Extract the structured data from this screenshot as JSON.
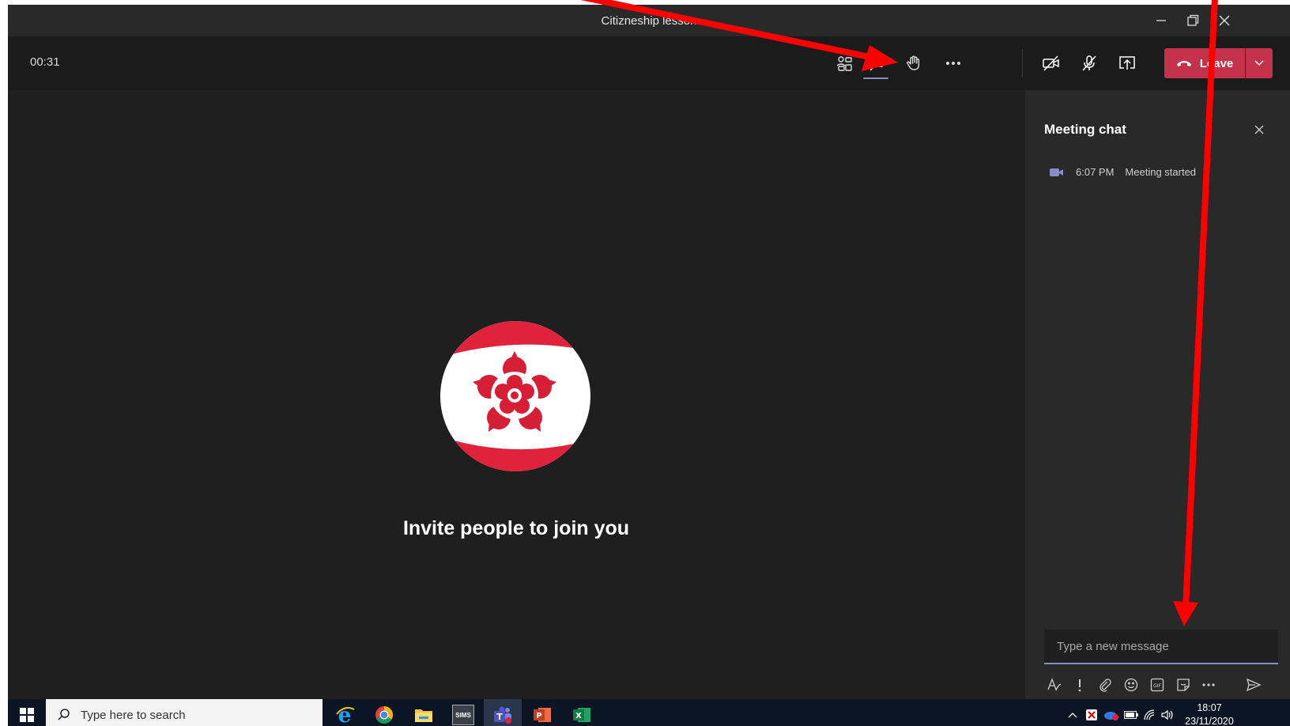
{
  "window": {
    "title": "Citizneship lesson"
  },
  "controls": {
    "timer": "00:31",
    "leave_label": "Leave"
  },
  "stage": {
    "invite_text": "Invite people to join you"
  },
  "chat": {
    "title": "Meeting chat",
    "events": [
      {
        "time": "6:07 PM",
        "text": "Meeting started",
        "icon": "video-camera-icon"
      }
    ],
    "compose_placeholder": "Type a new message"
  },
  "taskbar": {
    "search_placeholder": "Type here to search",
    "apps": [
      "internet-explorer",
      "chrome",
      "file-explorer",
      "sims",
      "teams",
      "powerpoint",
      "excel"
    ],
    "sims_label": "SIMS",
    "clock_time": "18:07",
    "clock_date": "23/11/2020"
  },
  "colors": {
    "teams_purple": "#8b8cc7",
    "leave_red": "#c4314b",
    "annotation_red": "#ff0000",
    "background": "#1f1f1f"
  }
}
